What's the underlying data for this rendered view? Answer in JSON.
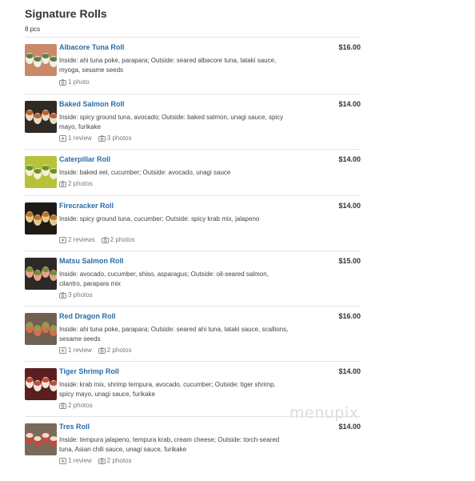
{
  "section": {
    "title": "Signature Rolls",
    "subtitle": "8 pcs"
  },
  "items": [
    {
      "name": "Albacore Tuna Roll",
      "price": "$16.00",
      "description": "Inside: ahi tuna poke, parapara; Outside: seared albacore tuna, tataki sauce, myoga, sesame seeds",
      "reviews": "",
      "photos": "1 photo"
    },
    {
      "name": "Baked Salmon Roll",
      "price": "$14.00",
      "description": "Inside: spicy ground tuna, avocado; Outside: baked salmon, unagi sauce, spicy mayo, furikake",
      "reviews": "1 review",
      "photos": "3 photos"
    },
    {
      "name": "Caterpillar Roll",
      "price": "$14.00",
      "description": "Inside: baked eel, cucumber; Outside: avocado, unagi sauce",
      "reviews": "",
      "photos": "2 photos"
    },
    {
      "name": "Firecracker Roll",
      "price": "$14.00",
      "description": "Inside: spicy ground tuna, cucumber; Outside: spicy krab mix, jalapeno",
      "reviews": "2 reviews",
      "photos": "2 photos"
    },
    {
      "name": "Matsu Salmon Roll",
      "price": "$15.00",
      "description": "Inside: avocado, cucumber, shiso, asparagus; Outside: oil-seared salmon, cilantro, parapara mix",
      "reviews": "",
      "photos": "3 photos"
    },
    {
      "name": "Red Dragon Roll",
      "price": "$16.00",
      "description": "Inside: ahi tuna poke, parapara; Outside: seared ahi tuna, tataki sauce, scallions, sesame seeds",
      "reviews": "1 review",
      "photos": "2 photos"
    },
    {
      "name": "Tiger Shrimp Roll",
      "price": "$14.00",
      "description": "Inside: krab mix, shrimp tempura, avocado, cucumber; Outside: tiger shrimp, spicy mayo, unagi sauce, furikake",
      "reviews": "",
      "photos": "2 photos"
    },
    {
      "name": "Tres Roll",
      "price": "$14.00",
      "description": "Inside: tempura jalapeno, tempura krab, cream cheese; Outside: torch-seared tuna, Asian chili sauce, unagi sauce, furikake",
      "reviews": "1 review",
      "photos": "2 photos"
    }
  ],
  "icons": {
    "review": "review-icon",
    "photo": "camera-icon"
  },
  "colors": {
    "link": "#2a6ca8",
    "meta": "#7a7a7a",
    "divider": "#e3e3e3"
  },
  "watermark": "menupix"
}
